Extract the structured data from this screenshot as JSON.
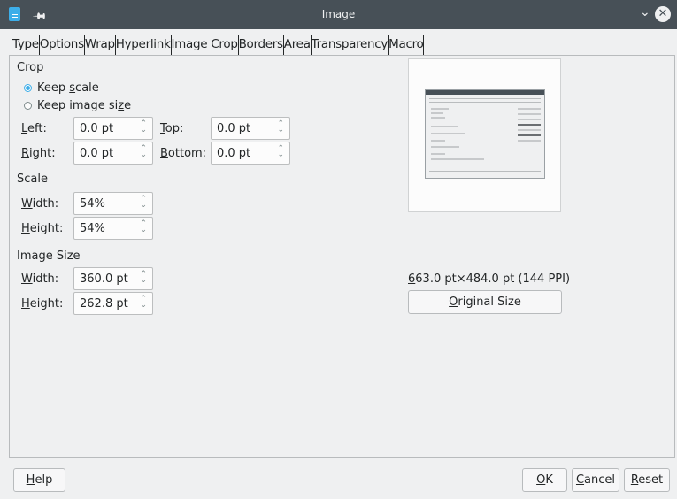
{
  "window": {
    "title": "Image"
  },
  "tabs": [
    "Type",
    "Options",
    "Wrap",
    "Hyperlink",
    "Image",
    "Crop",
    "Borders",
    "Area",
    "Transparency",
    "Macro"
  ],
  "active_tab": "Crop",
  "crop": {
    "heading": "Crop",
    "keep_scale_pre": "Keep ",
    "keep_scale_u": "s",
    "keep_scale_post": "cale",
    "keep_size_pre": "Keep image si",
    "keep_size_u": "z",
    "keep_size_post": "e",
    "selected": "keep_scale",
    "left_u": "L",
    "left_rest": "eft:",
    "left_value": "0.0 pt",
    "right_u": "R",
    "right_rest": "ight:",
    "right_value": "0.0 pt",
    "top_u": "T",
    "top_rest": "op:",
    "top_value": "0.0 pt",
    "bottom_u": "B",
    "bottom_rest": "ottom:",
    "bottom_value": "0.0 pt"
  },
  "scale": {
    "heading": "Scale",
    "width_u": "W",
    "width_rest": "idth:",
    "width_value": "54%",
    "height_u": "H",
    "height_rest": "eight:",
    "height_value": "54%"
  },
  "image_size": {
    "heading": "Image Size",
    "width_u": "W",
    "width_rest": "idth:",
    "width_value": "360.0 pt",
    "height_u": "H",
    "height_rest": "eight:",
    "height_value": "262.8 pt"
  },
  "original": {
    "info_u": "6",
    "info_rest": "63.0 pt×484.0 pt (144 PPI)",
    "button_u": "O",
    "button_rest": "riginal Size"
  },
  "buttons": {
    "help_u": "H",
    "help_rest": "elp",
    "ok_u": "O",
    "ok_rest": "K",
    "cancel_u": "C",
    "cancel_rest": "ancel",
    "reset_u": "R",
    "reset_rest": "eset"
  },
  "colors": {
    "titlebar": "#475057",
    "accent": "#3daee9",
    "background": "#eff0f1"
  }
}
